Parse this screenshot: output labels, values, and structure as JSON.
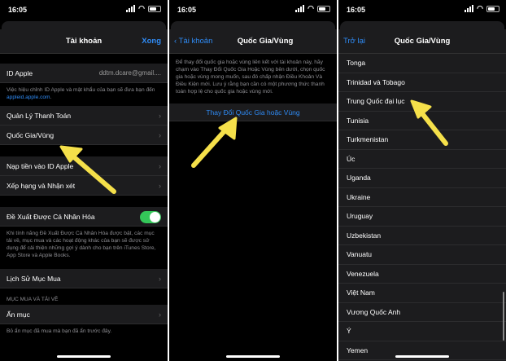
{
  "status": {
    "time": "16:05"
  },
  "screen1": {
    "title": "Tài khoản",
    "done": "Xong",
    "apple_id_label": "ID Apple",
    "apple_id_value": "ddtm.dcare@gmail....",
    "apple_id_note": "Việc hiệu chỉnh ID Apple và mật khẩu của bạn sẽ đưa bạn đến",
    "apple_id_link": "appleid.apple.com",
    "apple_id_note_end": ".",
    "payment": "Quản Lý Thanh Toán",
    "country": "Quốc Gia/Vùng",
    "topup": "Nạp tiền vào ID Apple",
    "ratings": "Xếp hạng và Nhận xét",
    "personalized": "Đề Xuất Được Cá Nhân Hóa",
    "personalized_note": "Khi tính năng Đề Xuất Được Cá Nhân Hóa được bật, các mục tải về, mục mua và các hoạt động khác của bạn sẽ được sử dụng để cải thiện những gợi ý dành cho bạn trên iTunes Store, App Store và Apple Books.",
    "history": "Lịch Sử Mục Mua",
    "section_purchases": "MỤC MUA VÀ TẢI VỀ",
    "hidden": "Ẩn mục",
    "hidden_note": "Bỏ ẩn mục đã mua mà bạn đã ẩn trước đây."
  },
  "screen2": {
    "back": "Tài khoản",
    "title": "Quốc Gia/Vùng",
    "note": "Để thay đổi quốc gia hoặc vùng liên kết với tài khoản này, hãy chạm vào Thay Đổi Quốc Gia Hoặc Vùng bên dưới, chọn quốc gia hoặc vùng mong muốn, sau đó chấp nhận Điều Khoản Và Điều Kiện mới. Lưu ý rằng bạn cần có một phương thức thanh toán hợp lệ cho quốc gia hoặc vùng mới.",
    "change_button": "Thay Đổi Quốc Gia hoặc Vùng"
  },
  "screen3": {
    "back": "Trở lại",
    "title": "Quốc Gia/Vùng",
    "countries": [
      "Tonga",
      "Trinidad và Tobago",
      "Trung Quốc đại lục",
      "Tunisia",
      "Turkmenistan",
      "Úc",
      "Uganda",
      "Ukraine",
      "Uruguay",
      "Uzbekistan",
      "Vanuatu",
      "Venezuela",
      "Việt Nam",
      "Vương Quốc Anh",
      "Ý",
      "Yemen"
    ]
  },
  "colors": {
    "accent": "#2f8bf5",
    "toggle_on": "#34c759",
    "arrow": "#f5e04a"
  }
}
